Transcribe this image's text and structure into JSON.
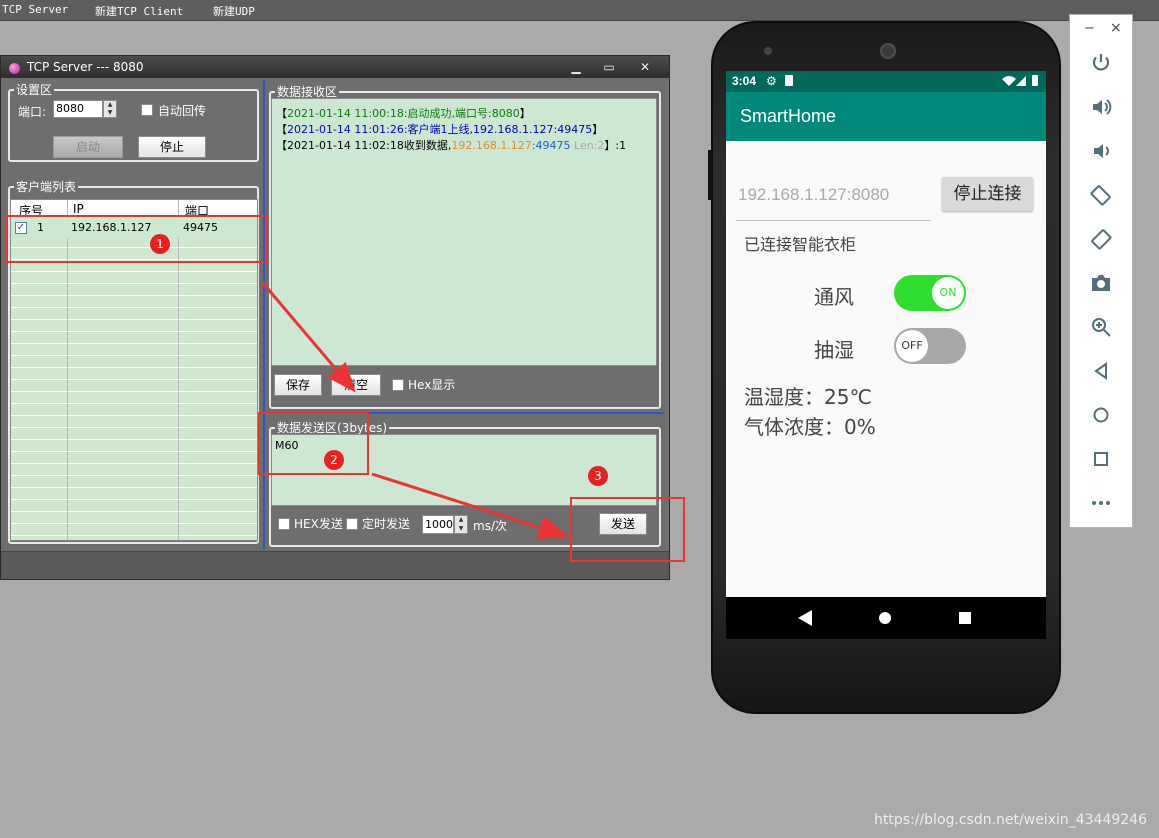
{
  "menubar": {
    "items": [
      "TCP Server",
      "新建TCP Client",
      "新建UDP"
    ]
  },
  "tcp_window": {
    "title": "TCP Server --- 8080",
    "controls": {
      "minimize": "▁",
      "maximize": "▭",
      "close": "✕"
    },
    "settings": {
      "group_title": "设置区",
      "port_label": "端口:",
      "port_value": "8080",
      "auto_echo_label": "自动回传",
      "start_button": "启动",
      "stop_button": "停止"
    },
    "client_list": {
      "group_title": "客户端列表",
      "columns": [
        "序号",
        "IP",
        "端口"
      ],
      "rows": [
        {
          "index": "1",
          "ip": "192.168.1.127",
          "port": "49475",
          "checked": true
        }
      ]
    },
    "receive": {
      "group_title": "数据接收区",
      "lines": [
        {
          "open": "【",
          "time": "2021-01-14 11:00:18",
          "sep": ":",
          "msg": "启动成功,端口号:8080",
          "close": "】"
        },
        {
          "open": "【",
          "time": "2021-01-14 11:01:26",
          "sep": ":",
          "msg": "客户端1上线,192.168.1.127:49475",
          "close": "】"
        },
        {
          "open": "【",
          "time": "2021-01-14 11:02:18",
          "msg": "收到数据,",
          "addr": "192.168.1.127",
          "port": ":49475",
          "len": " Len:2",
          "close": "】:1"
        }
      ],
      "save_button": "保存",
      "clear_button": "清空",
      "hex_display_label": "Hex显示"
    },
    "send": {
      "group_title": "数据发送区(3bytes)",
      "content": "M60",
      "hex_send_label": "HEX发送",
      "timed_send_label": "定时发送",
      "interval_value": "1000",
      "interval_unit": "ms/次",
      "send_button": "发送"
    },
    "annotations": [
      "1",
      "2",
      "3"
    ]
  },
  "phone": {
    "status": {
      "time": "3:04"
    },
    "app_title": "SmartHome",
    "address_value": "192.168.1.127:8080",
    "disconnect_button": "停止连接",
    "connection_status": "已连接智能衣柜",
    "toggles": [
      {
        "label": "通风",
        "state": "ON",
        "on": true
      },
      {
        "label": "抽湿",
        "state": "OFF",
        "on": false
      }
    ],
    "temperature_text": "温湿度：25℃",
    "gas_text": "气体浓度：0%"
  },
  "emulator_panel": {
    "window_controls": {
      "minimize": "−",
      "close": "×"
    },
    "icons": [
      "power-icon",
      "volume-up-icon",
      "volume-down-icon",
      "rotate-left-icon",
      "rotate-right-icon",
      "camera-icon",
      "zoom-icon",
      "back-icon",
      "home-icon",
      "overview-icon",
      "more-icon"
    ]
  },
  "watermark": "https://blog.csdn.net/weixin_43449246",
  "colors": {
    "switch_on": "#2ee02e",
    "switch_off": "#a8a8a8",
    "app_bar": "#00897b",
    "status_bar": "#00695c",
    "annotation_red": "#ee3333"
  }
}
